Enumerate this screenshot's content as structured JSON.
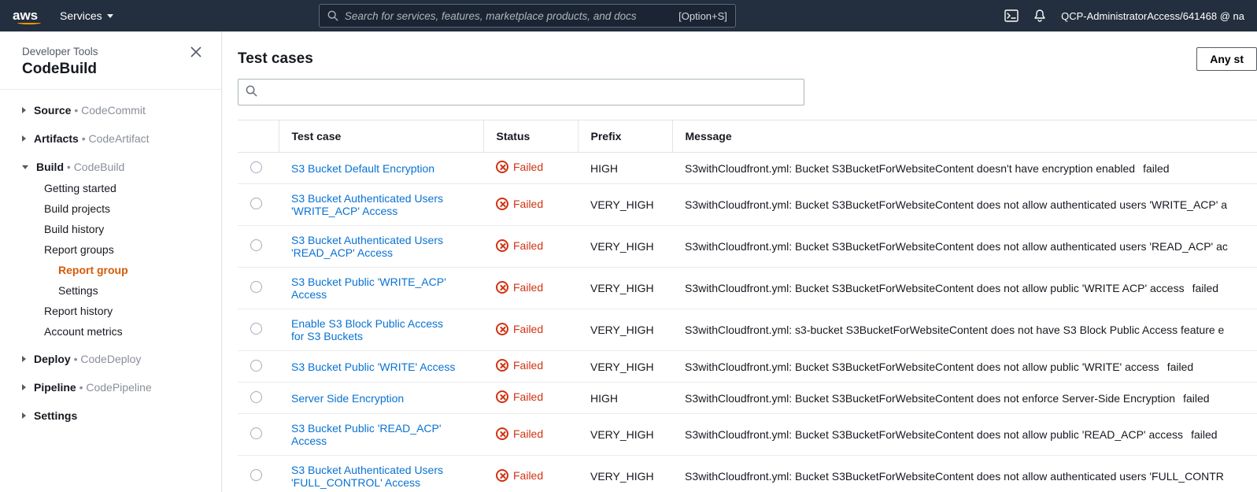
{
  "topnav": {
    "logo": "aws",
    "services": "Services",
    "search_placeholder": "Search for services, features, marketplace products, and docs",
    "shortcut": "[Option+S]",
    "account": "QCP-AdministratorAccess/641468 @ na"
  },
  "sidebar": {
    "subtitle": "Developer Tools",
    "title": "CodeBuild",
    "items": [
      {
        "main": "Source",
        "sub": "CodeCommit",
        "expanded": false
      },
      {
        "main": "Artifacts",
        "sub": "CodeArtifact",
        "expanded": false
      },
      {
        "main": "Build",
        "sub": "CodeBuild",
        "expanded": true,
        "children": [
          "Getting started",
          "Build projects",
          "Build history",
          "Report groups"
        ],
        "grandchildren": [
          "Report group",
          "Settings"
        ],
        "children2": [
          "Report history",
          "Account metrics"
        ]
      },
      {
        "main": "Deploy",
        "sub": "CodeDeploy",
        "expanded": false
      },
      {
        "main": "Pipeline",
        "sub": "CodePipeline",
        "expanded": false
      },
      {
        "main": "Settings",
        "sub": "",
        "expanded": false
      }
    ]
  },
  "main": {
    "title": "Test cases",
    "filter_button": "Any st",
    "columns": {
      "testcase": "Test case",
      "status": "Status",
      "prefix": "Prefix",
      "message": "Message"
    },
    "status_label": "Failed",
    "rows": [
      {
        "name": "S3 Bucket Default Encryption",
        "prefix": "HIGH",
        "msg": "S3withCloudfront.yml: Bucket S3BucketForWebsiteContent doesn't have encryption enabled",
        "extra": "failed"
      },
      {
        "name": "S3 Bucket Authenticated Users 'WRITE_ACP' Access",
        "prefix": "VERY_HIGH",
        "msg": "S3withCloudfront.yml: Bucket S3BucketForWebsiteContent does not allow authenticated users 'WRITE_ACP' a",
        "extra": ""
      },
      {
        "name": "S3 Bucket Authenticated Users 'READ_ACP' Access",
        "prefix": "VERY_HIGH",
        "msg": "S3withCloudfront.yml: Bucket S3BucketForWebsiteContent does not allow authenticated users 'READ_ACP' ac",
        "extra": ""
      },
      {
        "name": "S3 Bucket Public 'WRITE_ACP' Access",
        "prefix": "VERY_HIGH",
        "msg": "S3withCloudfront.yml: Bucket S3BucketForWebsiteContent does not allow public 'WRITE ACP' access",
        "extra": "failed"
      },
      {
        "name": "Enable S3 Block Public Access for S3 Buckets",
        "prefix": "VERY_HIGH",
        "msg": "S3withCloudfront.yml: s3-bucket S3BucketForWebsiteContent does not have S3 Block Public Access feature e",
        "extra": ""
      },
      {
        "name": "S3 Bucket Public 'WRITE' Access",
        "prefix": "VERY_HIGH",
        "msg": "S3withCloudfront.yml: Bucket S3BucketForWebsiteContent does not allow public 'WRITE' access",
        "extra": "failed"
      },
      {
        "name": "Server Side Encryption",
        "prefix": "HIGH",
        "msg": "S3withCloudfront.yml: Bucket S3BucketForWebsiteContent does not enforce Server-Side Encryption",
        "extra": "failed"
      },
      {
        "name": "S3 Bucket Public 'READ_ACP' Access",
        "prefix": "VERY_HIGH",
        "msg": "S3withCloudfront.yml: Bucket S3BucketForWebsiteContent does not allow public 'READ_ACP' access",
        "extra": "failed"
      },
      {
        "name": "S3 Bucket Authenticated Users 'FULL_CONTROL' Access",
        "prefix": "VERY_HIGH",
        "msg": "S3withCloudfront.yml: Bucket S3BucketForWebsiteContent does not allow authenticated users 'FULL_CONTR",
        "extra": ""
      }
    ]
  }
}
